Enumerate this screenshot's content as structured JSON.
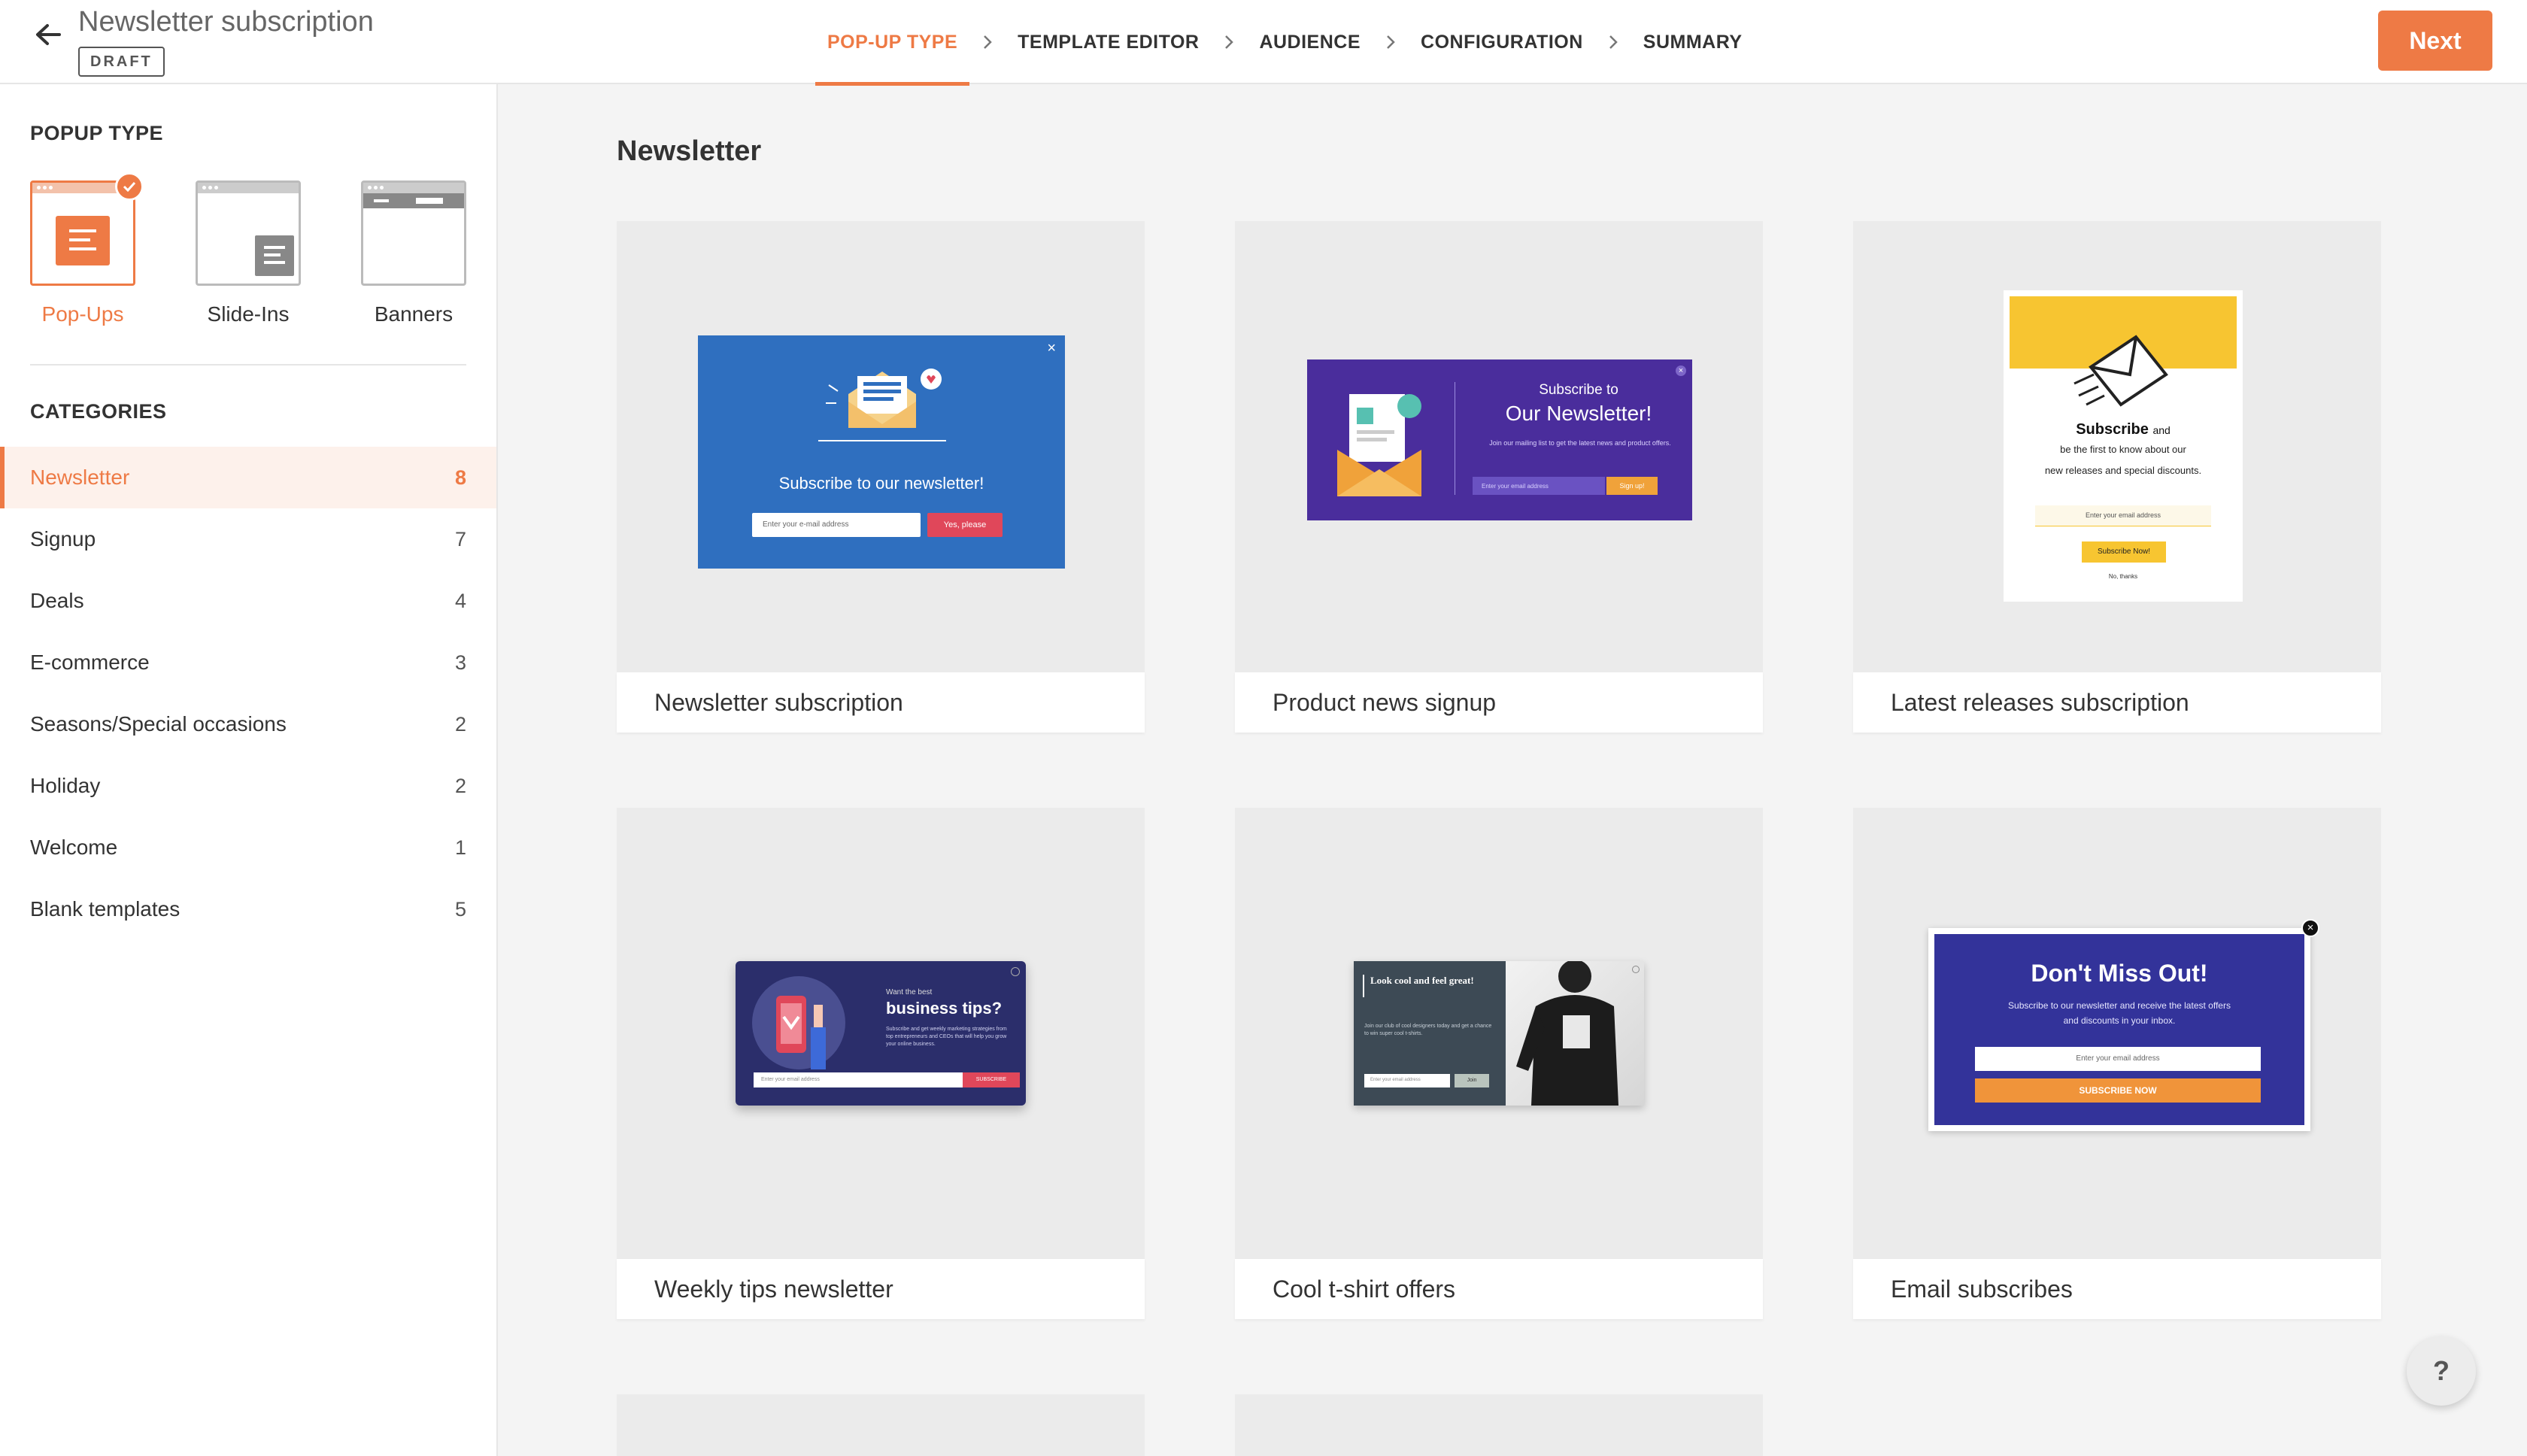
{
  "header": {
    "title": "Newsletter subscription",
    "badge": "DRAFT",
    "steps": [
      "POP-UP TYPE",
      "TEMPLATE EDITOR",
      "AUDIENCE",
      "CONFIGURATION",
      "SUMMARY"
    ],
    "active_step": "POP-UP TYPE",
    "next_label": "Next"
  },
  "sidebar": {
    "popup_type_title": "POPUP TYPE",
    "popup_types": [
      {
        "label": "Pop-Ups",
        "selected": true
      },
      {
        "label": "Slide-Ins",
        "selected": false
      },
      {
        "label": "Banners",
        "selected": false
      }
    ],
    "categories_title": "CATEGORIES",
    "categories": [
      {
        "label": "Newsletter",
        "count": "8",
        "active": true
      },
      {
        "label": "Signup",
        "count": "7"
      },
      {
        "label": "Deals",
        "count": "4"
      },
      {
        "label": "E-commerce",
        "count": "3"
      },
      {
        "label": "Seasons/Special occasions",
        "count": "2"
      },
      {
        "label": "Holiday",
        "count": "2"
      },
      {
        "label": "Welcome",
        "count": "1"
      },
      {
        "label": "Blank templates",
        "count": "5"
      }
    ]
  },
  "main": {
    "title": "Newsletter",
    "templates": [
      {
        "caption": "Newsletter subscription",
        "preview": {
          "headline": "Subscribe to our newsletter!",
          "placeholder": "Enter your e-mail address",
          "button": "Yes, please",
          "bg": "#2f6fbf",
          "button_color": "#e0475a"
        }
      },
      {
        "caption": "Product news signup",
        "preview": {
          "line1": "Subscribe to",
          "line2": "Our Newsletter!",
          "body": "Join our mailing list to get the latest news and product offers.",
          "placeholder": "Enter your email address",
          "button": "Sign up!",
          "bg": "#4a2d9c",
          "button_color": "#f0a23a"
        }
      },
      {
        "caption": "Latest releases subscription",
        "preview": {
          "headline": "Subscribe",
          "headline_suffix": "and",
          "body1": "be the first to know about our",
          "body2": "new releases and special discounts.",
          "placeholder": "Enter your email address",
          "button": "Subscribe Now!",
          "decline": "No, thanks",
          "accent": "#f7c531"
        }
      },
      {
        "caption": "Weekly tips newsletter",
        "preview": {
          "kicker": "Want the best",
          "headline": "business tips?",
          "body": "Subscribe and get weekly marketing strategies from top entrepreneurs and CEOs that will help you grow your online business.",
          "placeholder": "Enter your email address",
          "button": "SUBSCRIBE",
          "bg": "#2b2e6b",
          "button_color": "#e0475a"
        }
      },
      {
        "caption": "Cool t-shirt offers",
        "preview": {
          "headline": "Look cool and feel great!",
          "body": "Join our club of cool designers today and get a chance to win super cool t-shirts.",
          "placeholder": "Enter your email address",
          "button": "Join",
          "bg": "#3d4a55"
        }
      },
      {
        "caption": "Email subscribes",
        "preview": {
          "headline": "Don't Miss Out!",
          "body1": "Subscribe to our newsletter and receive the latest offers",
          "body2": "and discounts in your inbox.",
          "placeholder": "Enter your email address",
          "button": "SUBSCRIBE NOW",
          "bg": "#33339a",
          "button_color": "#f0943a"
        }
      }
    ]
  },
  "help_label": "?"
}
